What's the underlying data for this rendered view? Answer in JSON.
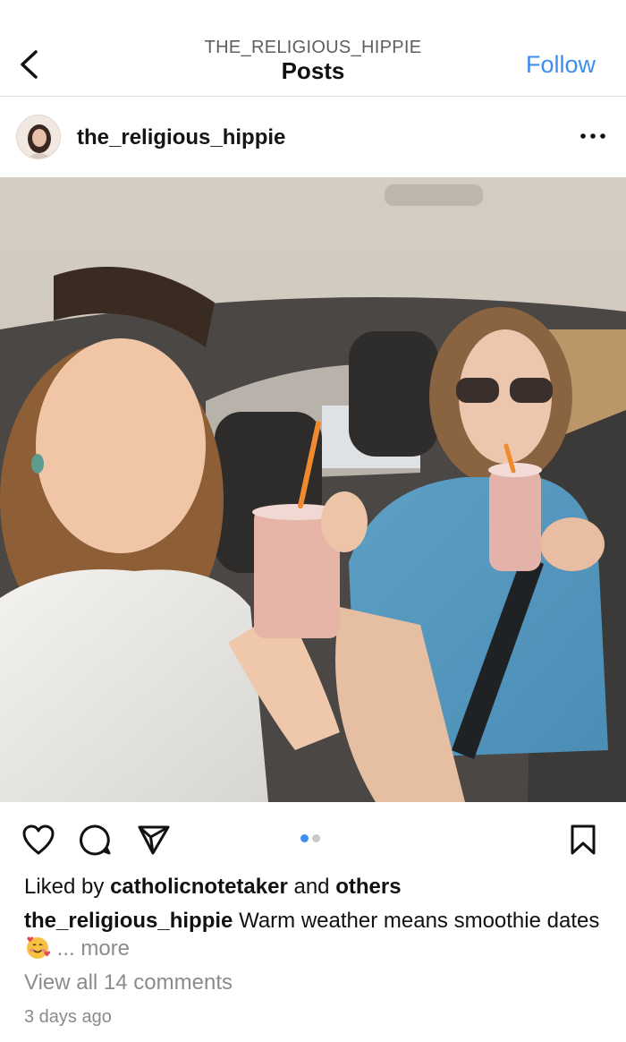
{
  "header": {
    "account_name": "THE_RELIGIOUS_HIPPIE",
    "title": "Posts",
    "follow_label": "Follow"
  },
  "post": {
    "username": "the_religious_hippie",
    "liked_prefix": "Liked by",
    "liked_user": "catholicnotetaker",
    "liked_and": "and",
    "liked_others": "others",
    "caption_user": "the_religious_hippie",
    "caption_text": "Warm weather means smoothie dates",
    "caption_emoji": "smiling-face-with-hearts",
    "caption_more": "... more",
    "view_comments": "View all 14 comments",
    "time_ago": "3 days ago",
    "carousel": {
      "total": 2,
      "active": 1
    }
  },
  "icons": {
    "back": "chevron-left-icon",
    "more": "more-horizontal-icon",
    "like": "heart-icon",
    "comment": "comment-icon",
    "share": "send-icon",
    "save": "bookmark-icon"
  },
  "colors": {
    "accent": "#3e8ef0",
    "muted": "#8b8b8b",
    "carousel_active": "#3e8ef0",
    "carousel_inactive": "#c9c9c9"
  }
}
